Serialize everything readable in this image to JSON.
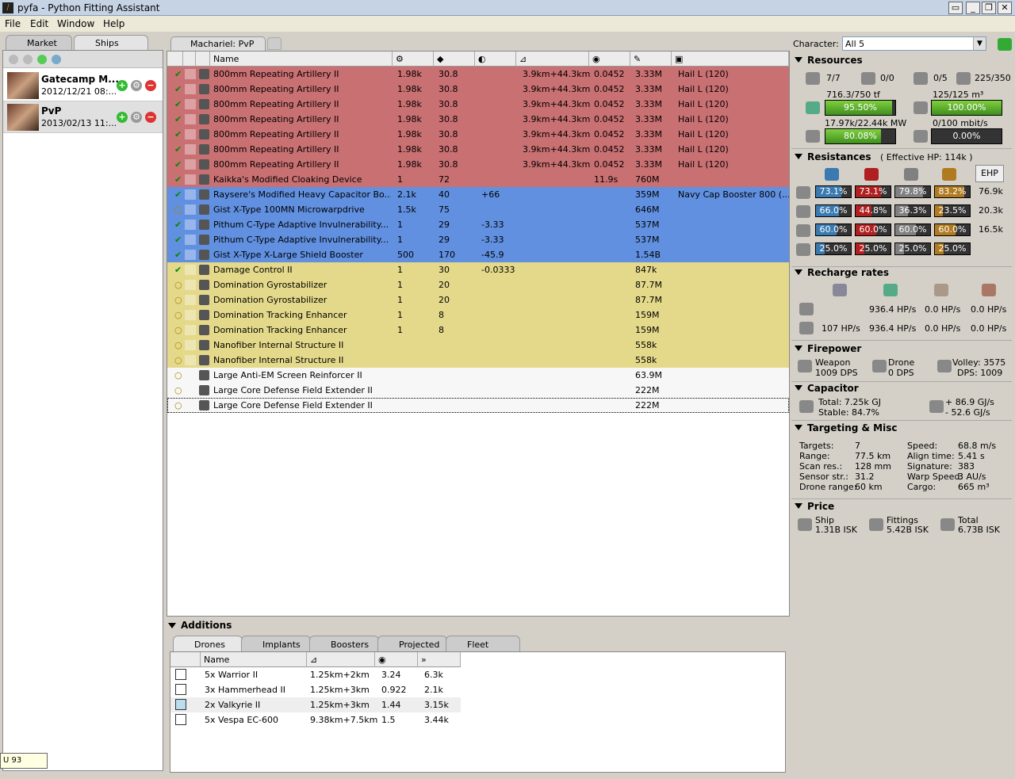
{
  "window": {
    "title": "pyfa - Python Fitting Assistant"
  },
  "menu": [
    "File",
    "Edit",
    "Window",
    "Help"
  ],
  "left": {
    "tabs": [
      "Market",
      "Ships"
    ],
    "fits": [
      {
        "name": "Gatecamp M...",
        "date": "2012/12/21 08:..."
      },
      {
        "name": "PvP",
        "date": "2013/02/13 11:..."
      }
    ],
    "status": "U 93"
  },
  "fit_tab": {
    "label": "Machariel: PvP"
  },
  "grid": {
    "headers": [
      "Name",
      "",
      "",
      "",
      "",
      "",
      "",
      ""
    ],
    "rows": [
      {
        "name": "800mm Repeating Artillery II",
        "c1": "1.98k",
        "c2": "30.8",
        "c3": "",
        "c4": "3.9km+44.3km",
        "c5": "0.0452",
        "c6": "3.33M",
        "c7": "Hail L (120)",
        "slot": "hi",
        "state": "on"
      },
      {
        "name": "800mm Repeating Artillery II",
        "c1": "1.98k",
        "c2": "30.8",
        "c3": "",
        "c4": "3.9km+44.3km",
        "c5": "0.0452",
        "c6": "3.33M",
        "c7": "Hail L (120)",
        "slot": "hi",
        "state": "on"
      },
      {
        "name": "800mm Repeating Artillery II",
        "c1": "1.98k",
        "c2": "30.8",
        "c3": "",
        "c4": "3.9km+44.3km",
        "c5": "0.0452",
        "c6": "3.33M",
        "c7": "Hail L (120)",
        "slot": "hi",
        "state": "on"
      },
      {
        "name": "800mm Repeating Artillery II",
        "c1": "1.98k",
        "c2": "30.8",
        "c3": "",
        "c4": "3.9km+44.3km",
        "c5": "0.0452",
        "c6": "3.33M",
        "c7": "Hail L (120)",
        "slot": "hi",
        "state": "on"
      },
      {
        "name": "800mm Repeating Artillery II",
        "c1": "1.98k",
        "c2": "30.8",
        "c3": "",
        "c4": "3.9km+44.3km",
        "c5": "0.0452",
        "c6": "3.33M",
        "c7": "Hail L (120)",
        "slot": "hi",
        "state": "on"
      },
      {
        "name": "800mm Repeating Artillery II",
        "c1": "1.98k",
        "c2": "30.8",
        "c3": "",
        "c4": "3.9km+44.3km",
        "c5": "0.0452",
        "c6": "3.33M",
        "c7": "Hail L (120)",
        "slot": "hi",
        "state": "on"
      },
      {
        "name": "800mm Repeating Artillery II",
        "c1": "1.98k",
        "c2": "30.8",
        "c3": "",
        "c4": "3.9km+44.3km",
        "c5": "0.0452",
        "c6": "3.33M",
        "c7": "Hail L (120)",
        "slot": "hi",
        "state": "on"
      },
      {
        "name": "Kaikka's Modified Cloaking Device",
        "c1": "1",
        "c2": "72",
        "c3": "",
        "c4": "",
        "c5": "11.9s",
        "c6": "760M",
        "c7": "",
        "slot": "hi",
        "state": "on"
      },
      {
        "name": "Raysere's Modified Heavy Capacitor Bo...",
        "c1": "2.1k",
        "c2": "40",
        "c3": "+66",
        "c4": "",
        "c5": "",
        "c6": "359M",
        "c7": "Navy Cap Booster 800 (...",
        "slot": "med",
        "state": "on"
      },
      {
        "name": "Gist X-Type 100MN Microwarpdrive",
        "c1": "1.5k",
        "c2": "75",
        "c3": "",
        "c4": "",
        "c5": "",
        "c6": "646M",
        "c7": "",
        "slot": "med",
        "state": "off"
      },
      {
        "name": "Pithum C-Type Adaptive Invulnerability...",
        "c1": "1",
        "c2": "29",
        "c3": "-3.33",
        "c4": "",
        "c5": "",
        "c6": "537M",
        "c7": "",
        "slot": "med",
        "state": "on"
      },
      {
        "name": "Pithum C-Type Adaptive Invulnerability...",
        "c1": "1",
        "c2": "29",
        "c3": "-3.33",
        "c4": "",
        "c5": "",
        "c6": "537M",
        "c7": "",
        "slot": "med",
        "state": "on"
      },
      {
        "name": "Gist X-Type X-Large Shield Booster",
        "c1": "500",
        "c2": "170",
        "c3": "-45.9",
        "c4": "",
        "c5": "",
        "c6": "1.54B",
        "c7": "",
        "slot": "med",
        "state": "on"
      },
      {
        "name": "Damage Control II",
        "c1": "1",
        "c2": "30",
        "c3": "-0.0333",
        "c4": "",
        "c5": "",
        "c6": "847k",
        "c7": "",
        "slot": "lo",
        "state": "on"
      },
      {
        "name": "Domination Gyrostabilizer",
        "c1": "1",
        "c2": "20",
        "c3": "",
        "c4": "",
        "c5": "",
        "c6": "87.7M",
        "c7": "",
        "slot": "lo",
        "state": "off"
      },
      {
        "name": "Domination Gyrostabilizer",
        "c1": "1",
        "c2": "20",
        "c3": "",
        "c4": "",
        "c5": "",
        "c6": "87.7M",
        "c7": "",
        "slot": "lo",
        "state": "off"
      },
      {
        "name": "Domination Tracking Enhancer",
        "c1": "1",
        "c2": "8",
        "c3": "",
        "c4": "",
        "c5": "",
        "c6": "159M",
        "c7": "",
        "slot": "lo",
        "state": "off"
      },
      {
        "name": "Domination Tracking Enhancer",
        "c1": "1",
        "c2": "8",
        "c3": "",
        "c4": "",
        "c5": "",
        "c6": "159M",
        "c7": "",
        "slot": "lo",
        "state": "off"
      },
      {
        "name": "Nanofiber Internal Structure II",
        "c1": "",
        "c2": "",
        "c3": "",
        "c4": "",
        "c5": "",
        "c6": "558k",
        "c7": "",
        "slot": "lo",
        "state": "off"
      },
      {
        "name": "Nanofiber Internal Structure II",
        "c1": "",
        "c2": "",
        "c3": "",
        "c4": "",
        "c5": "",
        "c6": "558k",
        "c7": "",
        "slot": "lo",
        "state": "off"
      },
      {
        "name": "Large Anti-EM Screen Reinforcer II",
        "c1": "",
        "c2": "",
        "c3": "",
        "c4": "",
        "c5": "",
        "c6": "63.9M",
        "c7": "",
        "slot": "rig",
        "state": "off"
      },
      {
        "name": "Large Core Defense Field Extender II",
        "c1": "",
        "c2": "",
        "c3": "",
        "c4": "",
        "c5": "",
        "c6": "222M",
        "c7": "",
        "slot": "rig",
        "state": "off"
      },
      {
        "name": "Large Core Defense Field Extender II",
        "c1": "",
        "c2": "",
        "c3": "",
        "c4": "",
        "c5": "",
        "c6": "222M",
        "c7": "",
        "slot": "rig",
        "state": "off"
      }
    ]
  },
  "additions": {
    "title": "Additions",
    "tabs": [
      "Drones",
      "Implants",
      "Boosters",
      "Projected",
      "Fleet"
    ],
    "headers": [
      "Name",
      "",
      "",
      ""
    ],
    "drones": [
      {
        "name": "5x Warrior II",
        "range": "1.25km+2km",
        "speed": "3.24",
        "dmg": "6.3k"
      },
      {
        "name": "3x Hammerhead II",
        "range": "1.25km+3km",
        "speed": "0.922",
        "dmg": "2.1k"
      },
      {
        "name": "2x Valkyrie II",
        "range": "1.25km+3km",
        "speed": "1.44",
        "dmg": "3.15k"
      },
      {
        "name": "5x Vespa EC-600",
        "range": "9.38km+7.5km",
        "speed": "1.5",
        "dmg": "3.44k"
      }
    ]
  },
  "stats": {
    "character_label": "Character:",
    "character": "All 5",
    "resources": {
      "title": "Resources",
      "turrets": "7/7",
      "launchers": "0/0",
      "calibration": "0/5",
      "drones": "225/350",
      "cpu_text": "716.3/750 tf",
      "cpu_pct": "95.50%",
      "cpu_fill": 0.955,
      "dronebay_text": "125/125 m³",
      "dronebay_pct": "100.00%",
      "dronebay_fill": 1.0,
      "pg_text": "17.97k/22.44k MW",
      "pg_pct": "80.08%",
      "pg_fill": 0.8008,
      "bw_text": "0/100 mbit/s",
      "bw_pct": "0.00%",
      "bw_fill": 0
    },
    "resistances": {
      "title": "Resistances",
      "ehp_label": "( Effective HP: 114k )",
      "ehp_button": "EHP",
      "rows": [
        {
          "vals": [
            "73.1%",
            "73.1%",
            "79.8%",
            "83.2%"
          ],
          "fills": [
            0.731,
            0.731,
            0.798,
            0.832
          ],
          "hp": "76.9k"
        },
        {
          "vals": [
            "66.0%",
            "44.8%",
            "36.3%",
            "23.5%"
          ],
          "fills": [
            0.66,
            0.448,
            0.363,
            0.235
          ],
          "hp": "20.3k"
        },
        {
          "vals": [
            "60.0%",
            "60.0%",
            "60.0%",
            "60.0%"
          ],
          "fills": [
            0.6,
            0.6,
            0.6,
            0.6
          ],
          "hp": "16.5k"
        },
        {
          "vals": [
            "25.0%",
            "25.0%",
            "25.0%",
            "25.0%"
          ],
          "fills": [
            0.25,
            0.25,
            0.25,
            0.25
          ],
          "hp": ""
        }
      ]
    },
    "recharge": {
      "title": "Recharge rates",
      "r1": [
        "",
        "936.4 HP/s",
        "0.0 HP/s",
        "0.0 HP/s"
      ],
      "r2": [
        "107 HP/s",
        "936.4 HP/s",
        "0.0 HP/s",
        "0.0 HP/s"
      ]
    },
    "firepower": {
      "title": "Firepower",
      "weapon": "Weapon",
      "weapon_dps": "1009 DPS",
      "drone": "Drone",
      "drone_dps": "0 DPS",
      "volley": "Volley: 3575",
      "dps": "DPS: 1009"
    },
    "capacitor": {
      "title": "Capacitor",
      "total": "Total: 7.25k GJ",
      "stable": "Stable: 84.7%",
      "plus": "+ 86.9 GJ/s",
      "minus": "- 52.6 GJ/s"
    },
    "targeting": {
      "title": "Targeting & Misc",
      "left": [
        [
          "Targets:",
          "7"
        ],
        [
          "Range:",
          "77.5 km"
        ],
        [
          "Scan res.:",
          "128 mm"
        ],
        [
          "Sensor str.:",
          "31.2"
        ],
        [
          "Drone range:",
          "60 km"
        ]
      ],
      "right": [
        [
          "Speed:",
          "68.8 m/s"
        ],
        [
          "Align time:",
          "5.41 s"
        ],
        [
          "Signature:",
          "383"
        ],
        [
          "Warp Speed:",
          "3 AU/s"
        ],
        [
          "Cargo:",
          "665 m³"
        ]
      ]
    },
    "price": {
      "title": "Price",
      "ship": "Ship",
      "ship_val": "1.31B ISK",
      "fittings": "Fittings",
      "fittings_val": "5.42B ISK",
      "total": "Total",
      "total_val": "6.73B ISK"
    }
  },
  "colors": {
    "hi": "#c97072",
    "med": "#6190e0",
    "lo": "#e4d98a",
    "rig": "#f7f7f7",
    "em": "#3a7ab0",
    "thermal": "#b02020",
    "kinetic": "#808080",
    "explosive": "#b07a20"
  }
}
